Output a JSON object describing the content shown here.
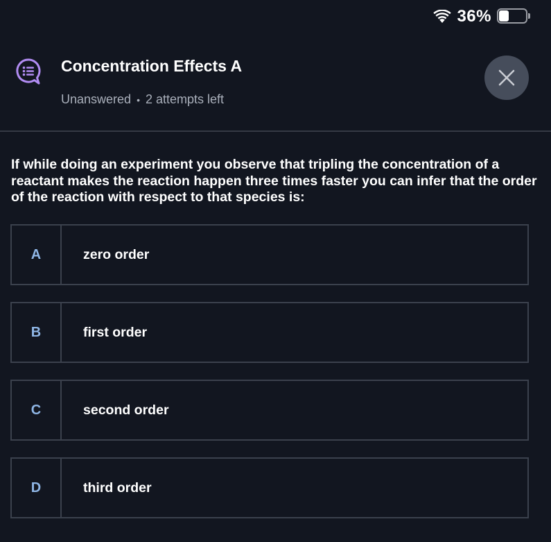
{
  "status_bar": {
    "battery_percent": "36%",
    "battery_level": 0.36,
    "icons": [
      "wifi-icon",
      "battery-icon"
    ]
  },
  "header": {
    "title": "Concentration Effects A",
    "status": "Unanswered",
    "attempts": "2 attempts left",
    "separator": "•",
    "icons": [
      "quiz-chat-icon",
      "close-icon"
    ]
  },
  "colors": {
    "background": "#121620",
    "accent_purple": "#b18cf2",
    "letter_blue": "#8fb6e6",
    "close_bg": "#464d5b",
    "border": "#3b414d"
  },
  "question": {
    "text": "If while doing an experiment you observe that tripling the concentration of a reactant makes the reaction happen three times faster you can infer that the order of the reaction with respect to that species is:"
  },
  "options": [
    {
      "letter": "A",
      "label": "zero order"
    },
    {
      "letter": "B",
      "label": "first order"
    },
    {
      "letter": "C",
      "label": "second order"
    },
    {
      "letter": "D",
      "label": "third order"
    }
  ]
}
